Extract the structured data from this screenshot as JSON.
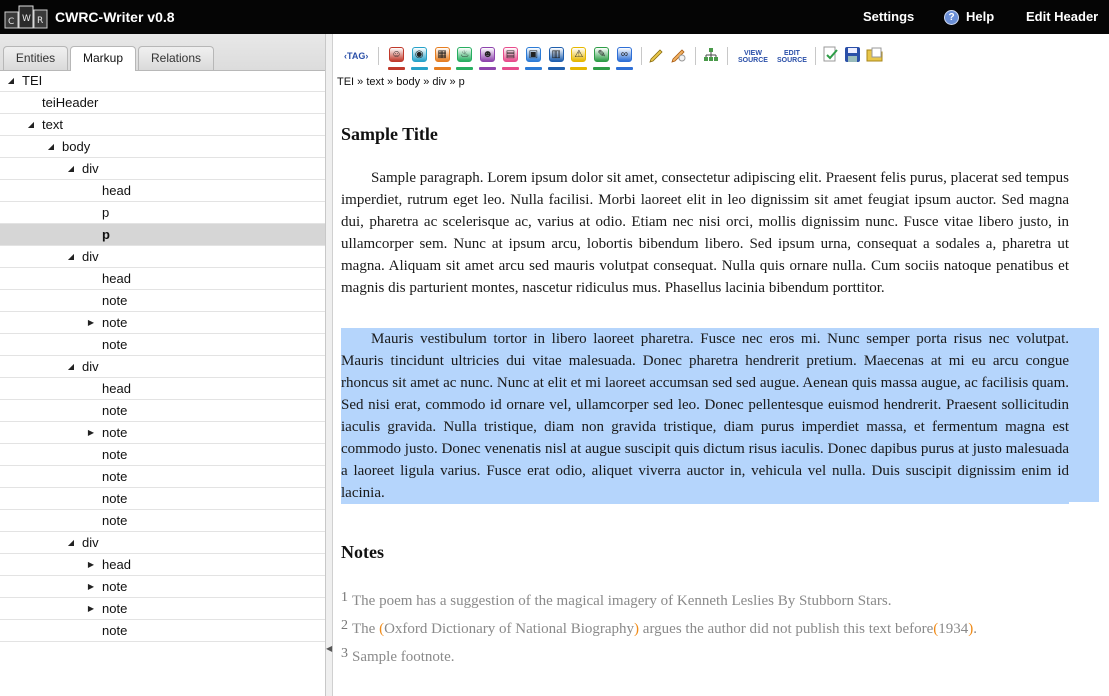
{
  "app": {
    "title": "CWRC-Writer v0.8",
    "nav": {
      "settings": "Settings",
      "help": "Help",
      "edit_header": "Edit Header"
    }
  },
  "left_tabs": [
    "Entities",
    "Markup",
    "Relations"
  ],
  "active_tab": "Markup",
  "tree": [
    {
      "label": "TEI",
      "depth": 0,
      "toggle": "expanded"
    },
    {
      "label": "teiHeader",
      "depth": 1,
      "toggle": "none"
    },
    {
      "label": "text",
      "depth": 1,
      "toggle": "expanded"
    },
    {
      "label": "body",
      "depth": 2,
      "toggle": "expanded"
    },
    {
      "label": "div",
      "depth": 3,
      "toggle": "expanded"
    },
    {
      "label": "head",
      "depth": 4,
      "toggle": "none"
    },
    {
      "label": "p",
      "depth": 4,
      "toggle": "none"
    },
    {
      "label": "p",
      "depth": 4,
      "toggle": "none",
      "selected": true
    },
    {
      "label": "div",
      "depth": 3,
      "toggle": "expanded"
    },
    {
      "label": "head",
      "depth": 4,
      "toggle": "none"
    },
    {
      "label": "note",
      "depth": 4,
      "toggle": "none"
    },
    {
      "label": "note",
      "depth": 4,
      "toggle": "collapsed"
    },
    {
      "label": "note",
      "depth": 4,
      "toggle": "none"
    },
    {
      "label": "div",
      "depth": 3,
      "toggle": "expanded"
    },
    {
      "label": "head",
      "depth": 4,
      "toggle": "none"
    },
    {
      "label": "note",
      "depth": 4,
      "toggle": "none"
    },
    {
      "label": "note",
      "depth": 4,
      "toggle": "collapsed"
    },
    {
      "label": "note",
      "depth": 4,
      "toggle": "none"
    },
    {
      "label": "note",
      "depth": 4,
      "toggle": "none"
    },
    {
      "label": "note",
      "depth": 4,
      "toggle": "none"
    },
    {
      "label": "note",
      "depth": 4,
      "toggle": "none"
    },
    {
      "label": "div",
      "depth": 3,
      "toggle": "expanded"
    },
    {
      "label": "head",
      "depth": 4,
      "toggle": "collapsed"
    },
    {
      "label": "note",
      "depth": 4,
      "toggle": "collapsed"
    },
    {
      "label": "note",
      "depth": 4,
      "toggle": "collapsed"
    },
    {
      "label": "note",
      "depth": 4,
      "toggle": "none"
    }
  ],
  "toolbar": {
    "tag_label": "‹TAG›",
    "view_source": "VIEW SOURCE",
    "edit_source": "EDIT SOURCE",
    "entity_buttons": [
      {
        "name": "person-tag-icon",
        "color": "#c0392b"
      },
      {
        "name": "place-tag-icon",
        "color": "#27a2c9"
      },
      {
        "name": "date-tag-icon",
        "color": "#e67e22"
      },
      {
        "name": "event-tag-icon",
        "color": "#27ae60"
      },
      {
        "name": "organization-tag-icon",
        "color": "#8e44ad"
      },
      {
        "name": "citation-tag-icon",
        "color": "#e74c8c"
      },
      {
        "name": "note-tag-icon",
        "color": "#2c7bd6"
      },
      {
        "name": "title-tag-icon",
        "color": "#1f5fae"
      },
      {
        "name": "correction-tag-icon",
        "color": "#e6b800"
      },
      {
        "name": "keyword-tag-icon",
        "color": "#2e9d47"
      },
      {
        "name": "link-tag-icon",
        "color": "#2e6fd6"
      }
    ]
  },
  "breadcrumb": "TEI » text » body » div » p",
  "document": {
    "title": "Sample Title",
    "paragraphs": [
      "Sample paragraph. Lorem ipsum dolor sit amet, consectetur adipiscing elit. Praesent felis purus, placerat sed tempus imperdiet, rutrum eget leo. Nulla facilisi. Morbi laoreet elit in leo dignissim sit amet feugiat ipsum auctor. Sed magna dui, pharetra ac scelerisque ac, varius at odio. Etiam nec nisi orci, mollis dignissim nunc. Fusce vitae libero justo, in ullamcorper sem. Nunc at ipsum arcu, lobortis bibendum libero. Sed ipsum urna, consequat a sodales a, pharetra ut magna. Aliquam sit amet arcu sed mauris volutpat consequat. Nulla quis ornare nulla. Cum sociis natoque penatibus et magnis dis parturient montes, nascetur ridiculus mus. Phasellus lacinia bibendum porttitor.",
      "Mauris vestibulum tortor in libero laoreet pharetra. Fusce nec eros mi. Nunc semper porta risus nec volutpat. Mauris tincidunt ultricies dui vitae malesuada. Donec pharetra hendrerit pretium. Maecenas at mi eu arcu congue rhoncus sit amet ac nunc. Nunc at elit et mi laoreet accumsan sed sed augue. Aenean quis massa augue, ac facilisis quam. Sed nisi erat, commodo id ornare vel, ullamcorper sed leo. Donec pellentesque euismod hendrerit. Praesent sollicitudin iaculis gravida. Nulla tristique, diam non gravida tristique, diam purus imperdiet massa, et fermentum magna est commodo justo. Donec venenatis nisl at augue suscipit quis dictum risus iaculis. Donec dapibus purus at justo malesuada a laoreet ligula varius. Fusce erat odio, aliquet viverra auctor in, vehicula vel nulla. Duis suscipit dignissim enim id lacinia."
    ],
    "notes_title": "Notes",
    "notes": [
      {
        "num": "1",
        "text": "The poem has a suggestion of the magical imagery of Kenneth Leslies By Stubborn Stars."
      },
      {
        "num": "2",
        "pre": "The ",
        "title": "Oxford Dictionary of National Biography",
        "mid": " argues the author did not publish this text before",
        "year": "1934",
        "post": "."
      },
      {
        "num": "3",
        "text": "Sample footnote."
      }
    ]
  },
  "colors": {
    "topbar": "#050505",
    "selection": "#b5d5fc",
    "note_text": "#8a8a8a",
    "entity_bracket": "#f08a16"
  }
}
